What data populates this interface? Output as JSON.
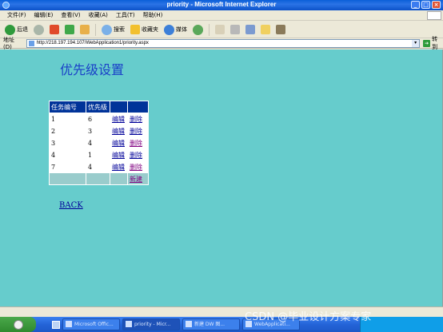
{
  "window": {
    "title": "priority - Microsoft Internet Explorer"
  },
  "menu": [
    "文件(F)",
    "编辑(E)",
    "查看(V)",
    "收藏(A)",
    "工具(T)",
    "帮助(H)"
  ],
  "toolbar": {
    "back_label": "后退",
    "search_label": "搜索",
    "favorites_label": "收藏夹",
    "media_label": "媒体"
  },
  "address": {
    "label": "地址(D)",
    "url": "http://218.197.194.107/WebApplication1/priority.aspx",
    "go_label": "转到"
  },
  "page": {
    "title": "优先级设置",
    "table": {
      "headers": [
        "任务编号",
        "优先级",
        "",
        ""
      ],
      "rows": [
        {
          "id": "1",
          "priority": "6",
          "edit": "编辑",
          "delete": "删除"
        },
        {
          "id": "2",
          "priority": "3",
          "edit": "编辑",
          "delete": "删除"
        },
        {
          "id": "3",
          "priority": "4",
          "edit": "编辑",
          "delete": "删除"
        },
        {
          "id": "4",
          "priority": "1",
          "edit": "编辑",
          "delete": "删除"
        },
        {
          "id": "7",
          "priority": "4",
          "edit": "编辑",
          "delete": "删除"
        }
      ],
      "new_label": "新建"
    },
    "back_label": "BACK"
  },
  "taskbar": {
    "tasks": [
      "Microsoft Offic...",
      "priority - Micr...",
      "新建 DW 图...",
      "WebApplicati..."
    ]
  },
  "watermark": "CSDN @毕业设计方案专家",
  "colors": {
    "page_bg": "#66cccc",
    "header_bg": "#003399",
    "footer_bg": "#99cccc",
    "title": "#1a3fc8"
  }
}
